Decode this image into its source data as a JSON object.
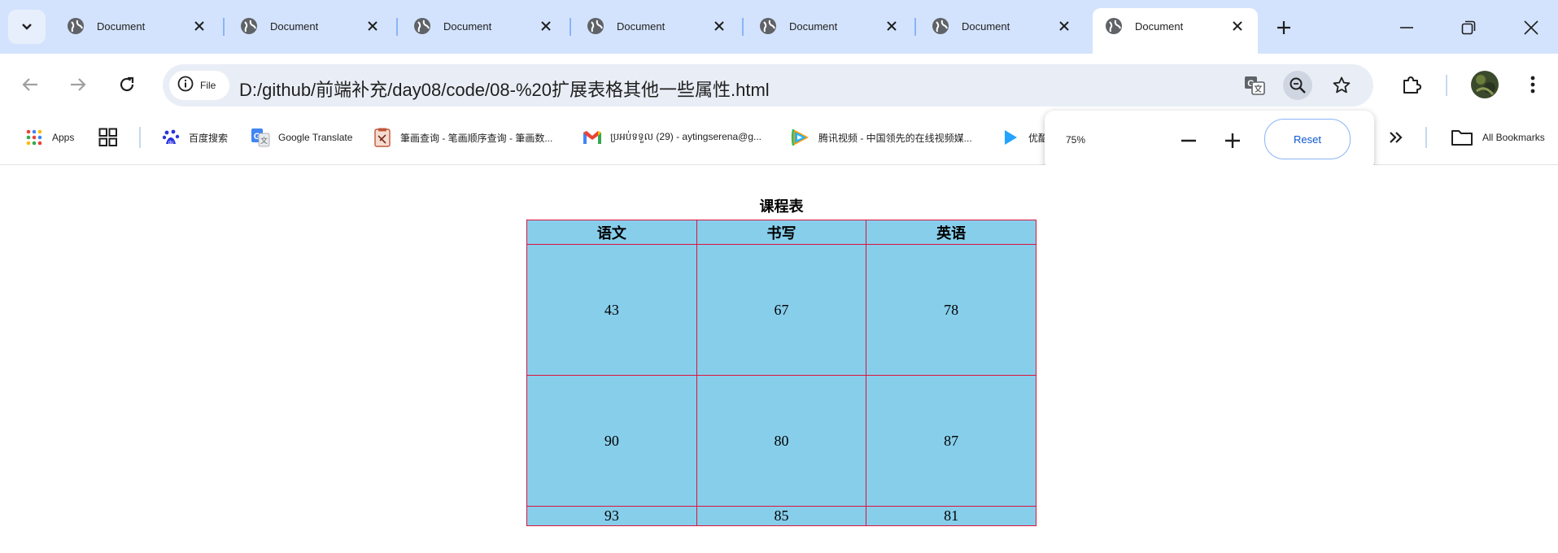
{
  "tabs": [
    {
      "title": "Document"
    },
    {
      "title": "Document"
    },
    {
      "title": "Document"
    },
    {
      "title": "Document"
    },
    {
      "title": "Document"
    },
    {
      "title": "Document"
    },
    {
      "title": "Document"
    }
  ],
  "toolbar": {
    "chip_label": "File",
    "url": "D:/github/前端补充/day08/code/08-%20扩展表格其他一些属性.html"
  },
  "bookmarks": [
    {
      "label": "Apps",
      "icon": "apps-grid-icon"
    },
    {
      "label": "",
      "icon": "tab-groups-icon"
    },
    {
      "label": "百度搜索",
      "icon": "baidu-icon"
    },
    {
      "label": "Google Translate",
      "icon": "google-translate-icon"
    },
    {
      "label": "筆画查询 - 笔画顺序查询 - 筆画数...",
      "icon": "stroke-order-icon"
    },
    {
      "label": "ប្រអប់ទទួល (29) - aytingserena@g...",
      "icon": "gmail-icon"
    },
    {
      "label": "腾讯视频 - 中国领先的在线视频媒...",
      "icon": "tencent-video-icon"
    },
    {
      "label": "优酷",
      "icon": "youku-icon"
    }
  ],
  "bookmarks_all": "All Bookmarks",
  "zoom": {
    "level": "75%",
    "reset_label": "Reset"
  },
  "table": {
    "caption": "课程表",
    "headers": [
      "语文",
      "书写",
      "英语"
    ],
    "rows": [
      [
        "43",
        "67",
        "78"
      ],
      [
        "90",
        "80",
        "87"
      ],
      [
        "93",
        "85",
        "81"
      ]
    ],
    "background": "#87ceeb",
    "border_color": "#dc143c"
  }
}
